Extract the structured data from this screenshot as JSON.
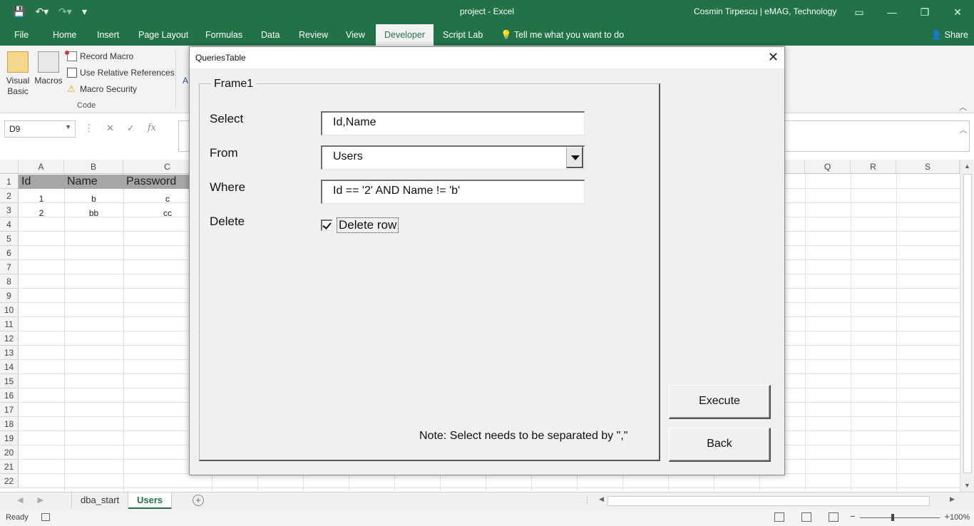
{
  "titlebar": {
    "title": "project  -  Excel",
    "user": "Cosmin Tirpescu | eMAG, Technology"
  },
  "menu": {
    "tabs": [
      "File",
      "Home",
      "Insert",
      "Page Layout",
      "Formulas",
      "Data",
      "Review",
      "View",
      "Developer",
      "Script Lab"
    ],
    "active": "Developer",
    "tell_me": "Tell me what you want to do",
    "share": "Share"
  },
  "ribbon": {
    "visual_basic": "Visual Basic",
    "macros": "Macros",
    "record_macro": "Record Macro",
    "relative_refs": "Use Relative References",
    "macro_security": "Macro Security",
    "group_label": "Code",
    "partial_label": "A"
  },
  "formula_bar": {
    "name_box": "D9",
    "fx": "fx"
  },
  "grid": {
    "columns": [
      "A",
      "B",
      "C",
      "Q",
      "R",
      "S"
    ],
    "rows": [
      "1",
      "2",
      "3",
      "4",
      "5",
      "6",
      "7",
      "8",
      "9",
      "10",
      "11",
      "12",
      "13",
      "14",
      "15",
      "16",
      "17",
      "18",
      "19",
      "20",
      "21",
      "22"
    ],
    "header_row": [
      "Id",
      "Name",
      "Password"
    ],
    "data": [
      [
        "1",
        "b",
        "c"
      ],
      [
        "2",
        "bb",
        "cc"
      ]
    ]
  },
  "sheets": {
    "tabs": [
      "dba_start",
      "Users"
    ],
    "active": "Users"
  },
  "status": {
    "ready": "Ready",
    "zoom": "100%"
  },
  "dialog": {
    "title": "QueriesTable",
    "frame_label": "Frame1",
    "select_label": "Select",
    "select_value": "Id,Name",
    "from_label": "From",
    "from_value": "Users",
    "where_label": "Where",
    "where_value": "Id == '2' AND Name != 'b'",
    "delete_label": "Delete",
    "delete_checkbox_label": "Delete row",
    "delete_checked": true,
    "note": "Note: Select needs to be separated by \",\"",
    "execute_button": "Execute",
    "back_button": "Back"
  },
  "colors": {
    "excel_green": "#217346",
    "header_fill": "#a6a6a6"
  }
}
